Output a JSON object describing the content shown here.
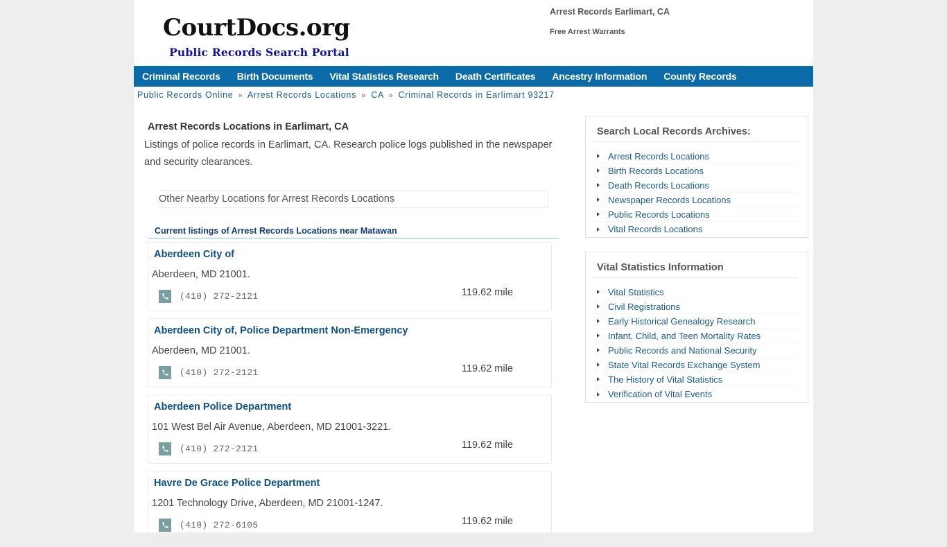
{
  "header": {
    "logo_title": "CourtDocs.org",
    "logo_subtitle": "Public Records Search Portal",
    "links": [
      "Arrest Records Earlimart, CA",
      "Free Arrest Warrants"
    ]
  },
  "nav": {
    "items": [
      "Criminal Records",
      "Birth Documents",
      "Vital Statistics Research",
      "Death Certificates",
      "Ancestry Information",
      "County Records"
    ]
  },
  "breadcrumb": {
    "items": [
      "Public Records Online",
      "Arrest Records Locations",
      "CA",
      "Criminal Records in Earlimart 93217"
    ],
    "separator": "»"
  },
  "main": {
    "title": "Arrest Records Locations in Earlimart, CA",
    "description": "Listings of police records in Earlimart, CA. Research police logs published in the newspaper and security clearances.",
    "nearby_label": "Other Nearby Locations for Arrest Records Locations",
    "listing_heading": "Current listings of Arrest Records Locations near Matawan",
    "listings": [
      {
        "name": "Aberdeen City of",
        "address": "Aberdeen, MD 21001.",
        "phone": "(410) 272-2121",
        "distance": "119.62 mile"
      },
      {
        "name": "Aberdeen City of, Police Department Non-Emergency",
        "address": "Aberdeen, MD 21001.",
        "phone": "(410) 272-2121",
        "distance": "119.62 mile"
      },
      {
        "name": "Aberdeen Police Department",
        "address": "101 West Bel Air Avenue, Aberdeen, MD 21001-3221.",
        "phone": "(410) 272-2121",
        "distance": "119.62 mile"
      },
      {
        "name": "Havre De Grace Police Department",
        "address": "1201 Technology Drive, Aberdeen, MD 21001-1247.",
        "phone": "(410) 272-6105",
        "distance": "119.62 mile"
      }
    ]
  },
  "sidebar": {
    "archives": {
      "title": "Search Local Records Archives:",
      "items": [
        "Arrest Records Locations",
        "Birth Records Locations",
        "Death Records Locations",
        "Newspaper Records Locations",
        "Public Records Locations",
        "Vital Records Locations"
      ]
    },
    "vital": {
      "title": "Vital Statistics Information",
      "items": [
        "Vital Statistics",
        "Civil Registrations",
        "Early Historical Genealogy Research",
        "Infant, Child, and Teen Mortality Rates",
        "Public Records and National Security",
        "State Vital Records Exchange System",
        "The History of Vital Statistics",
        "Verification of Vital Events"
      ]
    }
  },
  "colors": {
    "nav_bg": "#0b6aa8",
    "link": "#1a5c92",
    "listing_title": "#0d4f8a",
    "logo_subtitle": "#1010a0",
    "phone_icon_bg": "#7a9fa0"
  }
}
